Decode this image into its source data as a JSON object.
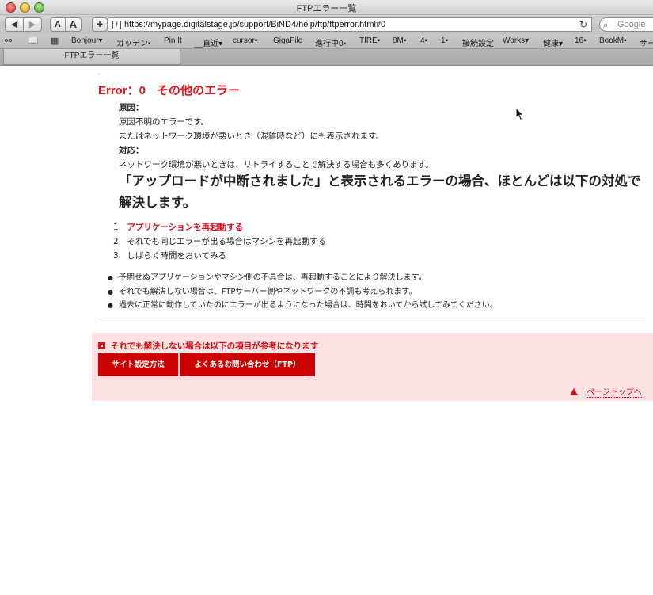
{
  "window": {
    "title": "FTPエラー一覧"
  },
  "toolbar": {
    "back_label": "◀",
    "forward_label": "▶",
    "font_small_label": "A",
    "font_large_label": "A",
    "add_label": "+",
    "url": "https://mypage.digitalstage.jp/support/BiND4/help/ftp/ftperror.html#0",
    "search_placeholder": "Google"
  },
  "bookmarks": {
    "items": [
      "Bonjour▾",
      "ガッテン▪",
      "Pin It",
      "__直近▾",
      "cursor▪",
      "GigaFile",
      "進行中0▪",
      "TIRE▪",
      "8M▪",
      "4▪",
      "1▪",
      "接続設定",
      "Works▾",
      "健康▾",
      "16▪",
      "BookM▪",
      "サー"
    ]
  },
  "tabs": [
    {
      "label": "FTPエラー一覧"
    }
  ],
  "content": {
    "error_code": "Error：0",
    "error_name": "その他のエラー",
    "cause_label": "原因：",
    "cause_lines": [
      "原因不明のエラーです。",
      "またはネットワーク環境が悪いとき（混雑時など）にも表示されます。"
    ],
    "action_label": "対応：",
    "action_line": "ネットワーク環境が悪いときは、リトライすることで解決する場合も多くあります。",
    "headline": "「アップロードが中断されました」と表示されるエラーの場合、ほとんどは以下の対処で解決します。",
    "steps": [
      {
        "num": "1.",
        "text": "アプリケーションを再起動する"
      },
      {
        "num": "2.",
        "text": "それでも同じエラーが出る場合はマシンを再起動する"
      },
      {
        "num": "3.",
        "text": "しばらく時間をおいてみる"
      }
    ],
    "bullets": [
      "予期せぬアプリケーションやマシン側の不具合は、再起動することにより解決します。",
      "それでも解決しない場合は、FTPサーバー側やネットワークの不調も考えられます。",
      "過去に正常に動作していたのにエラーが出るようになった場合は、時間をおいてから試してみてください。"
    ],
    "reference_heading": "それでも解決しない場合は以下の項目が参考になります",
    "button_site_settings": "サイト設定方法",
    "button_faq": "よくあるお問い合わせ（FTP）",
    "page_top_link": "ページトップへ"
  },
  "colors": {
    "accent_red": "#cc0000",
    "error_red": "#e8131a",
    "pink_bg": "#fce1e3"
  }
}
